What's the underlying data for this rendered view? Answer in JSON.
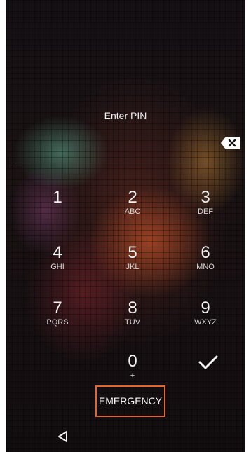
{
  "lock_screen": {
    "prompt": "Enter PIN"
  },
  "keypad": [
    {
      "digit": "1",
      "letters": ""
    },
    {
      "digit": "2",
      "letters": "ABC"
    },
    {
      "digit": "3",
      "letters": "DEF"
    },
    {
      "digit": "4",
      "letters": "GHI"
    },
    {
      "digit": "5",
      "letters": "JKL"
    },
    {
      "digit": "6",
      "letters": "MNO"
    },
    {
      "digit": "7",
      "letters": "PQRS"
    },
    {
      "digit": "8",
      "letters": "TUV"
    },
    {
      "digit": "9",
      "letters": "WXYZ"
    },
    {
      "digit": "0",
      "letters": "+"
    }
  ],
  "actions": {
    "emergency_label": "EMERGENCY",
    "backspace_icon": "backspace-icon",
    "confirm_icon": "checkmark-icon"
  },
  "navigation": {
    "back_icon": "back-triangle-icon"
  },
  "colors": {
    "background": "#151014",
    "text": "#f3f3f3",
    "highlight": "#e3672e"
  }
}
